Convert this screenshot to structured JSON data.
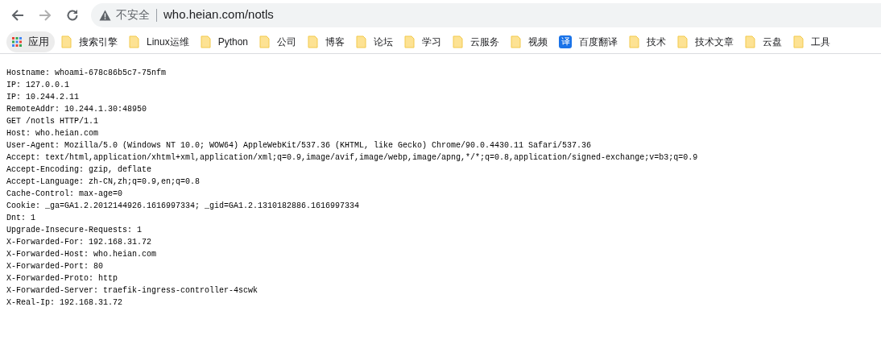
{
  "toolbar": {
    "back_disabled": false,
    "forward_disabled": true,
    "security_label": "不安全",
    "url": "who.heian.com/notls"
  },
  "bookmarks_bar": {
    "apps_label": "应用",
    "items": [
      {
        "kind": "folder",
        "label": "搜索引擎"
      },
      {
        "kind": "folder",
        "label": "Linux运维"
      },
      {
        "kind": "folder",
        "label": "Python"
      },
      {
        "kind": "folder",
        "label": "公司"
      },
      {
        "kind": "folder",
        "label": "博客"
      },
      {
        "kind": "folder",
        "label": "论坛"
      },
      {
        "kind": "folder",
        "label": "学习"
      },
      {
        "kind": "folder",
        "label": "云服务"
      },
      {
        "kind": "folder",
        "label": "视频"
      },
      {
        "kind": "translate",
        "label": "百度翻译",
        "icon_text": "译"
      },
      {
        "kind": "folder",
        "label": "技术"
      },
      {
        "kind": "folder",
        "label": "技术文章"
      },
      {
        "kind": "folder",
        "label": "云盘"
      },
      {
        "kind": "folder",
        "label": "工具"
      }
    ]
  },
  "page_lines": [
    "Hostname: whoami-678c86b5c7-75nfm",
    "IP: 127.0.0.1",
    "IP: 10.244.2.11",
    "RemoteAddr: 10.244.1.30:48950",
    "GET /notls HTTP/1.1",
    "Host: who.heian.com",
    "User-Agent: Mozilla/5.0 (Windows NT 10.0; WOW64) AppleWebKit/537.36 (KHTML, like Gecko) Chrome/90.0.4430.11 Safari/537.36",
    "Accept: text/html,application/xhtml+xml,application/xml;q=0.9,image/avif,image/webp,image/apng,*/*;q=0.8,application/signed-exchange;v=b3;q=0.9",
    "Accept-Encoding: gzip, deflate",
    "Accept-Language: zh-CN,zh;q=0.9,en;q=0.8",
    "Cache-Control: max-age=0",
    "Cookie: _ga=GA1.2.2012144926.1616997334; _gid=GA1.2.1310182886.1616997334",
    "Dnt: 1",
    "Upgrade-Insecure-Requests: 1",
    "X-Forwarded-For: 192.168.31.72",
    "X-Forwarded-Host: who.heian.com",
    "X-Forwarded-Port: 80",
    "X-Forwarded-Proto: http",
    "X-Forwarded-Server: traefik-ingress-controller-4scwk",
    "X-Real-Ip: 192.168.31.72"
  ]
}
